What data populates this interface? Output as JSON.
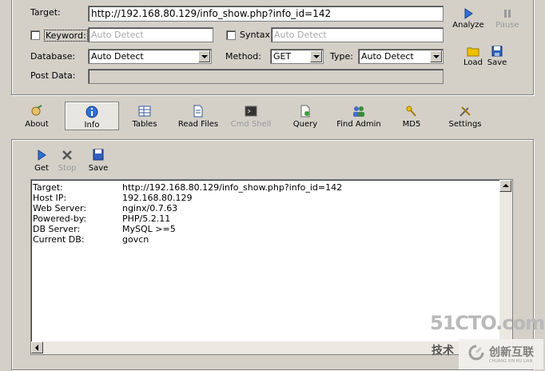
{
  "target": {
    "label": "Target:",
    "value": "http://192.168.80.129/info_show.php?info_id=142"
  },
  "keyword": {
    "label": "Keyword:",
    "placeholder": "Auto Detect"
  },
  "syntax": {
    "label": "Syntax:",
    "placeholder": "Auto Detect"
  },
  "database": {
    "label": "Database:",
    "value": "Auto Detect"
  },
  "method": {
    "label": "Method:",
    "value": "GET"
  },
  "type": {
    "label": "Type:",
    "value": "Auto Detect"
  },
  "post_data": {
    "label": "Post Data:",
    "value": ""
  },
  "actions": {
    "analyze": "Analyze",
    "pause": "Pause",
    "load": "Load",
    "save": "Save"
  },
  "toolbar": {
    "about": "About",
    "info": "Info",
    "tables": "Tables",
    "read_files": "Read Files",
    "cmd_shell": "Cmd Shell",
    "query": "Query",
    "find_admin": "Find Admin",
    "md5": "MD5",
    "settings": "Settings"
  },
  "info_toolbar": {
    "get": "Get",
    "stop": "Stop",
    "save": "Save"
  },
  "output": {
    "rows": [
      {
        "key": "Target:",
        "value": "http://192.168.80.129/info_show.php?info_id=142"
      },
      {
        "key": "Host IP:",
        "value": "192.168.80.129"
      },
      {
        "key": "Web Server:",
        "value": "nginx/0.7.63"
      },
      {
        "key": "Powered-by:",
        "value": "PHP/5.2.11"
      },
      {
        "key": "DB Server:",
        "value": "MySQL >=5"
      },
      {
        "key": "Current DB:",
        "value": "govcn"
      }
    ]
  },
  "watermark": {
    "site": "51CTO.com",
    "sub": "技术",
    "brand": "创新互联",
    "brand_sub": "CHUANG XIN HU LIAN"
  }
}
